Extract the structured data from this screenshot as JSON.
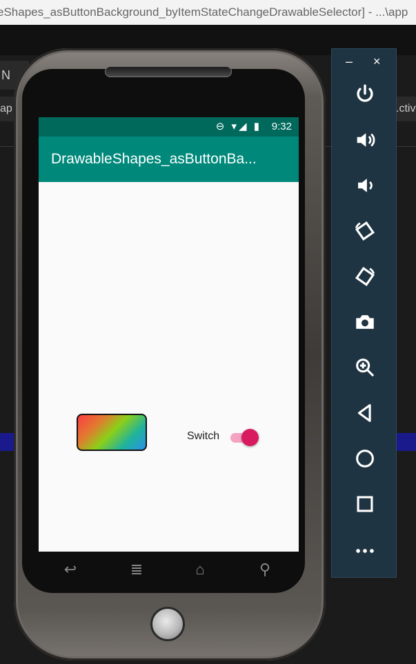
{
  "window_title": "eShapes_asButtonBackground_byItemStateChangeDrawableSelector] - ...\\app",
  "ide": {
    "toolbar_fragment": "N",
    "left_tab_fragment": "ap",
    "right_tab_fragment": ".ctiv"
  },
  "status_bar": {
    "time": "9:32",
    "icons": "⊖ ▾◢ ▮"
  },
  "app": {
    "title": "DrawableShapes_asButtonBa...",
    "switch_label": "Switch",
    "switch_state": "on"
  },
  "phone_nav": {
    "back": "↩",
    "menu": "≣",
    "home": "⌂",
    "search": "⚲"
  },
  "emulator_panel": {
    "minimize": "–",
    "close": "×",
    "buttons": [
      {
        "name": "power-icon"
      },
      {
        "name": "volume-up-icon"
      },
      {
        "name": "volume-down-icon"
      },
      {
        "name": "rotate-left-icon"
      },
      {
        "name": "rotate-right-icon"
      },
      {
        "name": "camera-icon"
      },
      {
        "name": "zoom-icon"
      },
      {
        "name": "back-icon"
      },
      {
        "name": "home-icon"
      },
      {
        "name": "overview-icon"
      },
      {
        "name": "more-icon"
      }
    ]
  },
  "colors": {
    "status_bar": "#00695c",
    "app_bar": "#00897b",
    "switch_thumb": "#d81b60",
    "emulator_panel": "#1f3442"
  }
}
